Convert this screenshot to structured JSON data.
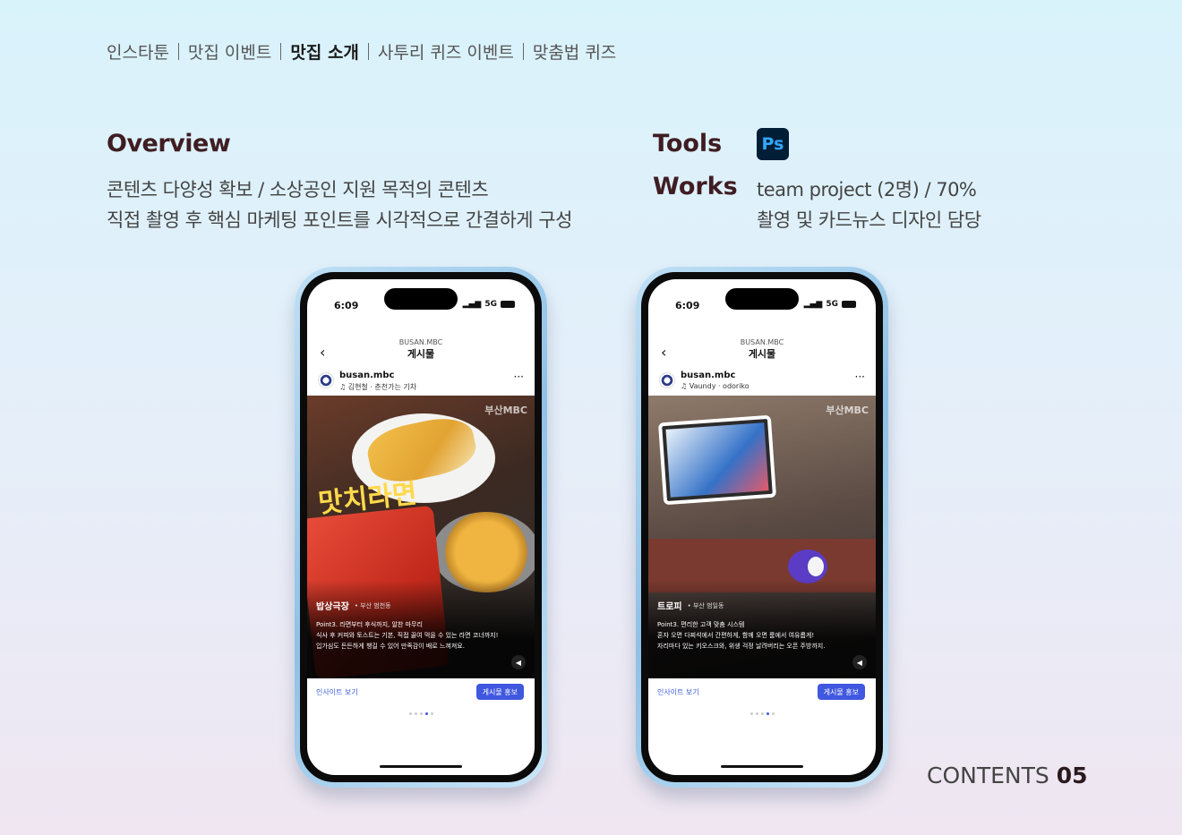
{
  "nav": {
    "items": [
      "인스타툰",
      "맛집 이벤트",
      "맛집 소개",
      "사투리 퀴즈 이벤트",
      "맞춤법 퀴즈"
    ],
    "active": "맛집 소개"
  },
  "overview": {
    "title": "Overview",
    "lines": [
      "콘텐츠 다양성 확보 / 소상공인 지원 목적의 콘텐츠",
      "직접 촬영 후 핵심 마케팅 포인트를 시각적으로 간결하게 구성"
    ]
  },
  "tools": {
    "label": "Tools",
    "icon": "photoshop-icon",
    "icon_text": "Ps"
  },
  "works": {
    "label": "Works",
    "lines": [
      "team project (2명) / 70%",
      "촬영 및 카드뉴스 디자인 담당"
    ]
  },
  "contents": {
    "label": "CONTENTS",
    "number": "05"
  },
  "phones": [
    {
      "time": "6:09",
      "network": "5G",
      "account_header": "BUSAN.MBC",
      "title": "게시물",
      "username": "busan.mbc",
      "song": "♫ 김현철 · 춘천가는 기차",
      "watermark": "부산MBC",
      "pack_text": "맛치라면",
      "place": "밥상극장",
      "location": "• 부산 범천동",
      "caption": [
        "Point3. 라면부터 후식까지, 알찬 마무리",
        "식사 후 커피와 토스트는 기본, 직접 끓여 먹을 수 있는 라면 코너까지!",
        "입가심도 든든하게 챙길 수 있어 만족감이 배로 느껴져요."
      ],
      "insight": "인사이트 보기",
      "promote": "게시물 홍보"
    },
    {
      "time": "6:09",
      "network": "5G",
      "account_header": "BUSAN.MBC",
      "title": "게시물",
      "username": "busan.mbc",
      "song": "♫ Vaundy · odoriko",
      "watermark": "부산MBC",
      "place": "트로피",
      "location": "• 부산 범일동",
      "caption": [
        "Point3. 편리한 고객 맞춤 시스템",
        "혼자 오면 다찌석에서 간편하게, 함께 오면 룸에서 여유롭게!",
        "자리마다 있는 키오스크와, 위생 걱정 날려버리는 오픈 주방까지."
      ],
      "insight": "인사이트 보기",
      "promote": "게시물 홍보"
    }
  ]
}
